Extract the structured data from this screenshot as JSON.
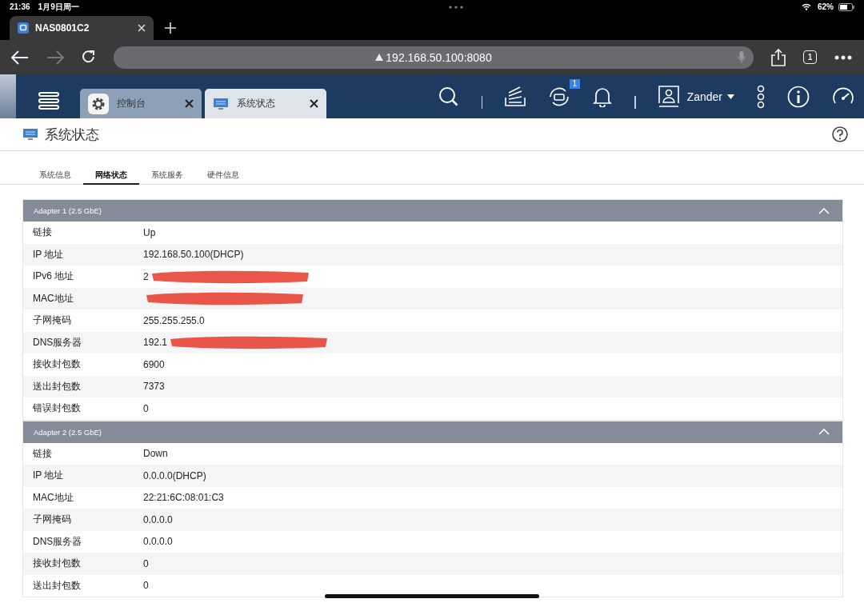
{
  "status_bar": {
    "time": "21:36",
    "date": "1月9日周一",
    "battery": "62%"
  },
  "browser": {
    "tabs": [
      {
        "title": "NAS0801C2",
        "selected": true
      }
    ],
    "url": "192.168.50.100:8080",
    "tab_count": "1"
  },
  "app_tabs": [
    {
      "label": "控制台",
      "selected": false
    },
    {
      "label": "系统状态",
      "selected": true
    }
  ],
  "header": {
    "badge": "1",
    "user": "Zander"
  },
  "page_title": "系统状态",
  "subtabs": [
    {
      "label": "系统信息",
      "selected": false
    },
    {
      "label": "网络状态",
      "selected": true
    },
    {
      "label": "系统服务",
      "selected": false
    },
    {
      "label": "硬件信息",
      "selected": false
    }
  ],
  "adapters": [
    {
      "title": "Adapter 1 (2.5 GbE)",
      "expanded": true,
      "rows": [
        {
          "label": "链接",
          "value": "Up",
          "redacted": false
        },
        {
          "label": "IP 地址",
          "value": "192.168.50.100(DHCP)",
          "redacted": false
        },
        {
          "label": "IPv6 地址",
          "value": "2",
          "redacted": true
        },
        {
          "label": "MAC地址",
          "redacted": true
        },
        {
          "label": "子网掩码",
          "value": "255.255.255.0",
          "redacted": false
        },
        {
          "label": "DNS服务器",
          "value": "192.1",
          "redacted": true
        },
        {
          "label": "接收封包数",
          "value": "6900",
          "redacted": false
        },
        {
          "label": "送出封包数",
          "value": "7373",
          "redacted": false
        },
        {
          "label": "错误封包数",
          "value": "0",
          "redacted": false
        }
      ]
    },
    {
      "title": "Adapter 2 (2.5 GbE)",
      "expanded": true,
      "rows": [
        {
          "label": "链接",
          "value": "Down",
          "redacted": false
        },
        {
          "label": "IP 地址",
          "value": "0.0.0.0(DHCP)",
          "redacted": false
        },
        {
          "label": "MAC地址",
          "value": "22:21:6C:08:01:C3",
          "redacted": false
        },
        {
          "label": "子网掩码",
          "value": "0.0.0.0",
          "redacted": false
        },
        {
          "label": "DNS服务器",
          "value": "0.0.0.0",
          "redacted": false
        },
        {
          "label": "接收封包数",
          "value": "0",
          "redacted": false
        },
        {
          "label": "送出封包数",
          "value": "0",
          "redacted": false
        }
      ]
    }
  ]
}
